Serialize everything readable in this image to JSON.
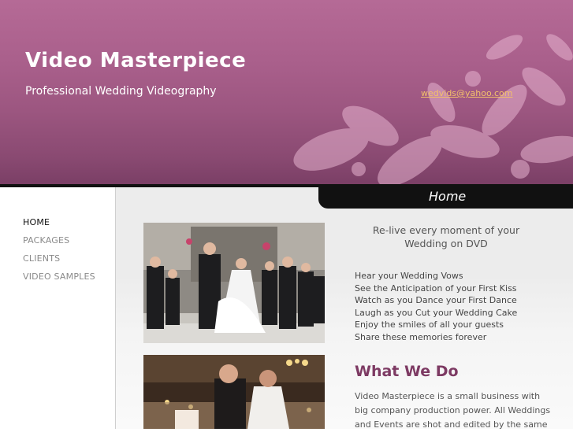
{
  "header": {
    "title": "Video Masterpiece",
    "subtitle": "Professional Wedding Videography",
    "email": "wedvids@yahoo.com"
  },
  "nav": {
    "items": [
      {
        "label": "HOME",
        "active": true
      },
      {
        "label": "PACKAGES",
        "active": false
      },
      {
        "label": "CLIENTS",
        "active": false
      },
      {
        "label": "VIDEO SAMPLES",
        "active": false
      }
    ]
  },
  "main": {
    "tab_label": "Home",
    "tagline": "Re-live every moment of your Wedding on DVD",
    "features": [
      "Hear your Wedding Vows",
      "See the Anticipation of your First Kiss",
      "Watch as you Dance your First Dance",
      "Laugh as you Cut your Wedding Cake",
      "Enjoy the smiles of all your guests",
      "Share these memories forever"
    ],
    "section_title": "What We Do",
    "section_body": "Video Masterpiece is a small business with big company production power. All Weddings and Events are shot and edited by the same"
  },
  "colors": {
    "header": "#a95f8b",
    "accent_title": "#7d3a63",
    "email_link": "#f3c06a"
  }
}
